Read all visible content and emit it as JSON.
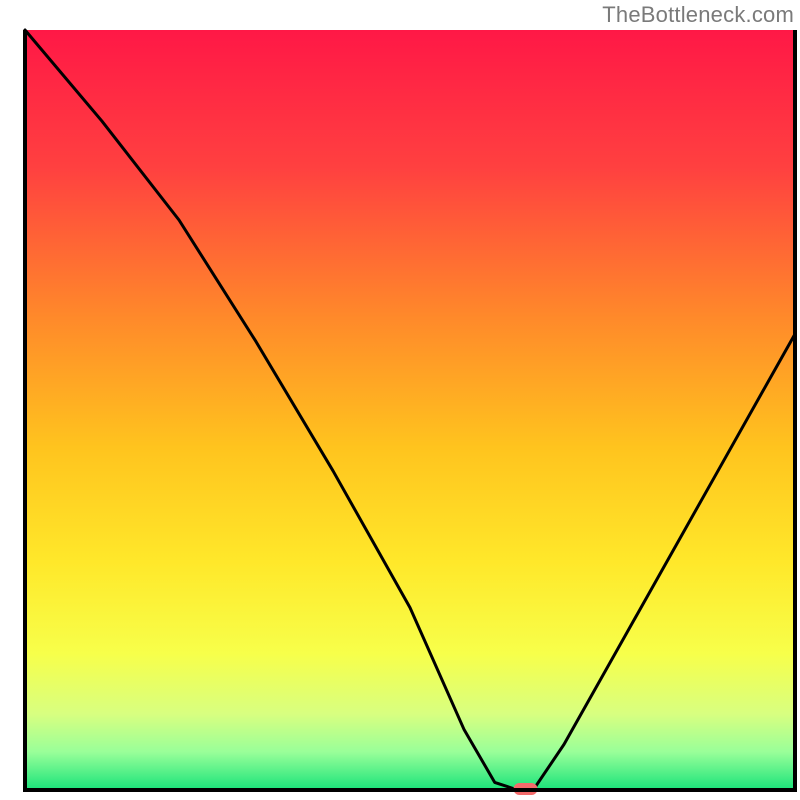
{
  "watermark": "TheBottleneck.com",
  "chart_data": {
    "type": "line",
    "title": "",
    "xlabel": "",
    "ylabel": "",
    "xlim": [
      0,
      100
    ],
    "ylim": [
      0,
      100
    ],
    "series": [
      {
        "name": "bottleneck-curve",
        "x": [
          0,
          10,
          20,
          30,
          40,
          50,
          57,
          61,
          64,
          66,
          70,
          80,
          90,
          100
        ],
        "values": [
          100,
          88,
          75,
          59,
          42,
          24,
          8,
          1,
          0,
          0,
          6,
          24,
          42,
          60
        ]
      }
    ],
    "marker": {
      "x": 65,
      "y": 0,
      "color": "#f36b6b"
    },
    "gradient_stops": [
      {
        "offset": 0.0,
        "color": "#ff1846"
      },
      {
        "offset": 0.18,
        "color": "#ff4040"
      },
      {
        "offset": 0.38,
        "color": "#ff8a2a"
      },
      {
        "offset": 0.55,
        "color": "#ffc41e"
      },
      {
        "offset": 0.7,
        "color": "#ffe82a"
      },
      {
        "offset": 0.82,
        "color": "#f7ff4a"
      },
      {
        "offset": 0.9,
        "color": "#d8ff80"
      },
      {
        "offset": 0.95,
        "color": "#99ff99"
      },
      {
        "offset": 1.0,
        "color": "#19e37a"
      }
    ],
    "axes_color": "#000000",
    "curve_color": "#000000"
  }
}
